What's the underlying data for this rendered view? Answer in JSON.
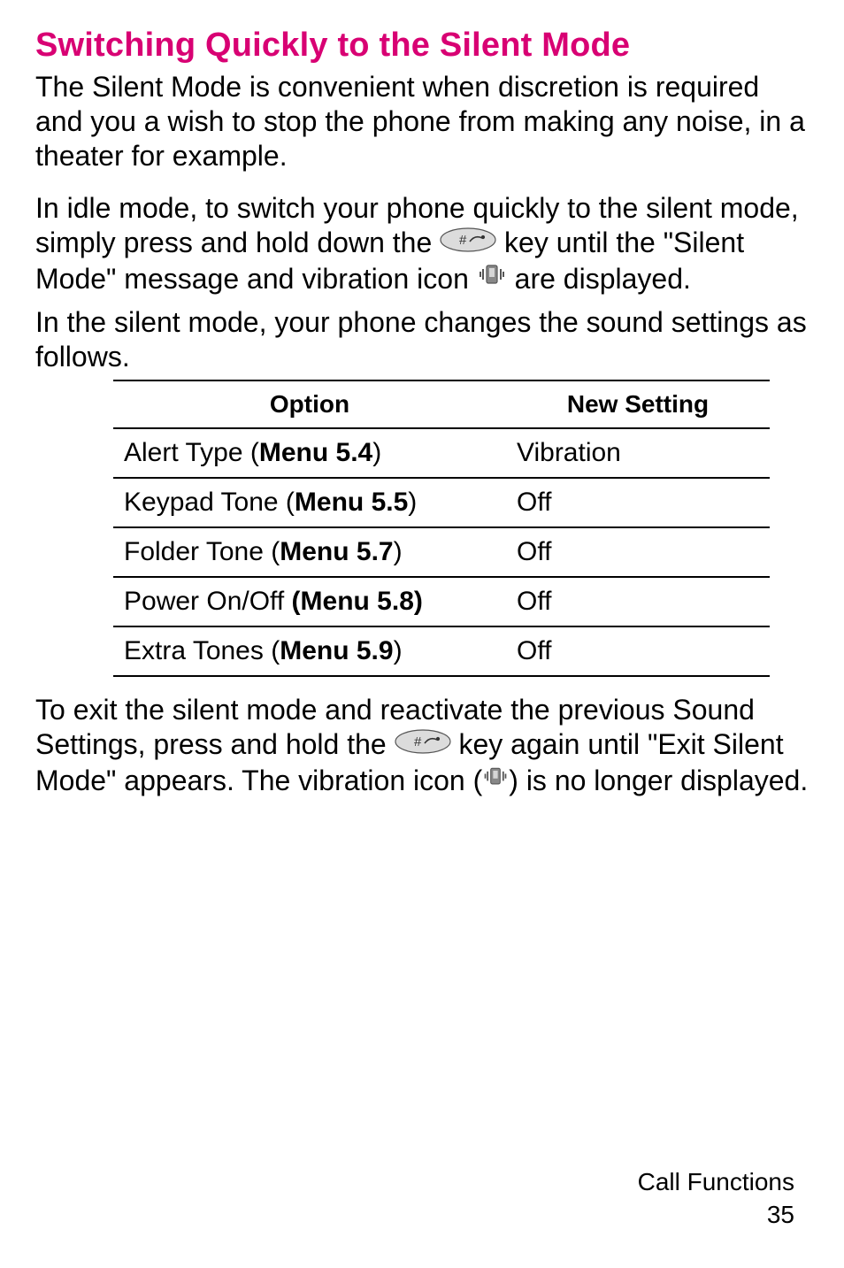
{
  "heading": "Switching Quickly to the Silent Mode",
  "para1": "The Silent Mode is convenient when discretion is required and you a wish to stop the phone from making any noise, in a theater for example.",
  "para2_a": "In idle mode, to switch your phone quickly to the silent mode, simply press and hold down the ",
  "para2_b": " key until the \"Silent Mode\" message and vibration icon ",
  "para2_c": " are displayed.",
  "para3": "In the silent mode, your phone changes the sound settings as follows.",
  "table": {
    "headers": {
      "option": "Option",
      "new_setting": "New Setting"
    },
    "rows": [
      {
        "label_pre": "Alert Type (",
        "label_bold": "Menu 5.4",
        "label_post": ")",
        "value": "Vibration"
      },
      {
        "label_pre": "Keypad Tone (",
        "label_bold": "Menu 5.5",
        "label_post": ")",
        "value": "Off"
      },
      {
        "label_pre": "Folder Tone (",
        "label_bold": "Menu 5.7",
        "label_post": ")",
        "value": "Off"
      },
      {
        "label_pre": "Power On/Off ",
        "label_bold": "(Menu 5.8)",
        "label_post": "",
        "value": "Off"
      },
      {
        "label_pre": "Extra Tones (",
        "label_bold": "Menu 5.9",
        "label_post": ")",
        "value": "Off"
      }
    ]
  },
  "para4_a": "To exit the silent mode and reactivate the previous Sound Settings, press and hold the ",
  "para4_b": " key again until \"Exit Silent Mode\" appears. The vibration icon (",
  "para4_c": ") is no longer displayed.",
  "footer": {
    "title": "Call Functions",
    "page": "35"
  }
}
